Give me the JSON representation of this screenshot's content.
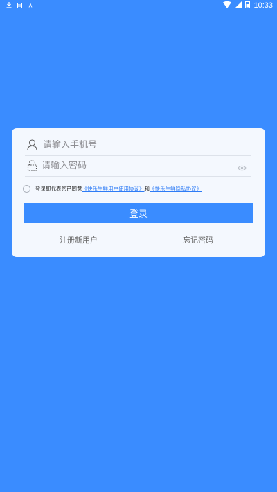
{
  "status_bar": {
    "time": "10:33",
    "left_icons": [
      "download-icon",
      "storage-icon",
      "a-box-icon"
    ],
    "right_icons": [
      "wifi-icon",
      "signal-icon",
      "battery-icon"
    ]
  },
  "colors": {
    "background": "#3A8CFF",
    "card": "#F4F8FE",
    "button": "#3A8CFF",
    "link": "#2E7CF6"
  },
  "login_form": {
    "phone_placeholder": "请输入手机号",
    "phone_value": "",
    "password_placeholder": "请输入密码",
    "password_value": "",
    "agreement": {
      "prefix": "登录即代表您已同意",
      "user_agreement": "《快乐牛鲜用户使用协议》",
      "and": "和",
      "privacy_agreement": "《快乐牛鲜隐私协议》",
      "checked": false
    },
    "login_label": "登录",
    "register_label": "注册新用户",
    "forgot_label": "忘记密码"
  }
}
